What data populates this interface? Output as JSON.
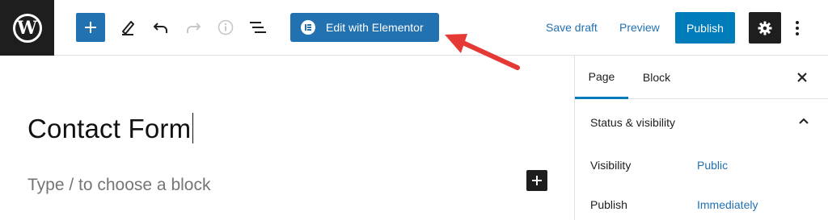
{
  "toolbar": {
    "edit_elementor_label": "Edit with Elementor",
    "save_draft_label": "Save draft",
    "preview_label": "Preview",
    "publish_label": "Publish",
    "icons": [
      "wordpress-logo",
      "add-block-icon",
      "pencil-icon",
      "undo-icon",
      "redo-icon",
      "info-icon",
      "list-view-icon",
      "elementor-icon",
      "settings-gear-icon",
      "more-options-icon"
    ]
  },
  "editor": {
    "title": "Contact Form",
    "block_placeholder": "Type / to choose a block"
  },
  "sidebar": {
    "tabs": [
      {
        "label": "Page",
        "active": true
      },
      {
        "label": "Block",
        "active": false
      }
    ],
    "section_title": "Status & visibility",
    "rows": [
      {
        "label": "Visibility",
        "value": "Public"
      },
      {
        "label": "Publish",
        "value": "Immediately"
      }
    ]
  },
  "colors": {
    "accent": "#2271b1",
    "publish": "#007cba",
    "arrow": "#e53935",
    "dark": "#1e1e1e"
  }
}
